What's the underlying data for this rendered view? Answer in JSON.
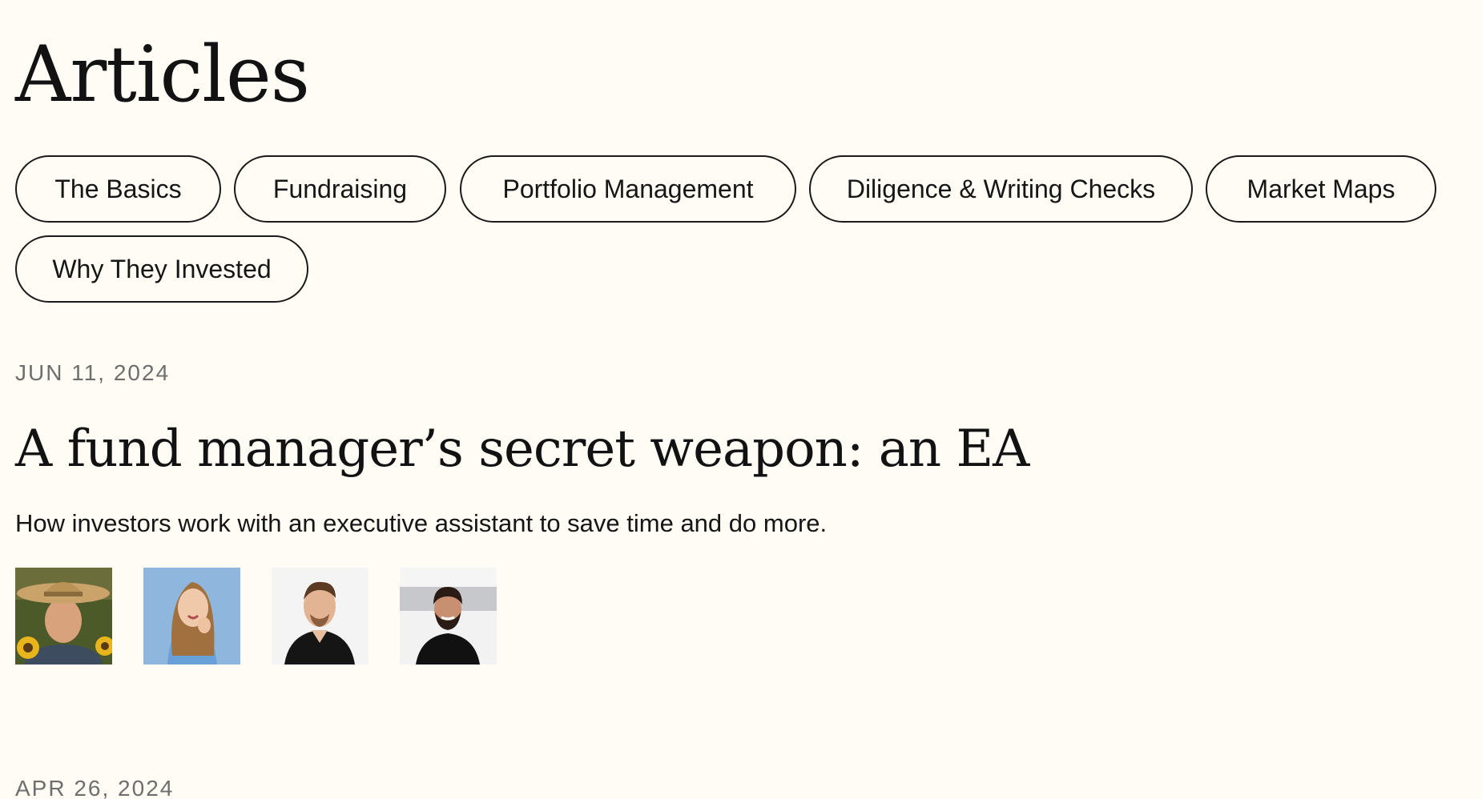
{
  "page": {
    "title": "Articles"
  },
  "categories": [
    {
      "label": "The Basics"
    },
    {
      "label": "Fundraising"
    },
    {
      "label": "Portfolio Management"
    },
    {
      "label": "Diligence & Writing Checks"
    },
    {
      "label": "Market Maps"
    },
    {
      "label": "Why They Invested"
    }
  ],
  "articles": [
    {
      "date": "JUN 11, 2024",
      "title": "A fund manager’s secret weapon: an EA",
      "summary": "How investors work with an executive assistant to save time and do more.",
      "authors": [
        {
          "icon": "author-avatar-hat-sunflowers"
        },
        {
          "icon": "author-avatar-woman-blue"
        },
        {
          "icon": "author-avatar-man-black-shirt"
        },
        {
          "icon": "author-avatar-man-beard"
        }
      ]
    },
    {
      "date": "APR 26, 2024"
    }
  ],
  "colors": {
    "background": "#fffcf5",
    "text": "#121212",
    "muted": "#6e6e6e",
    "border": "#1a1a1a"
  }
}
